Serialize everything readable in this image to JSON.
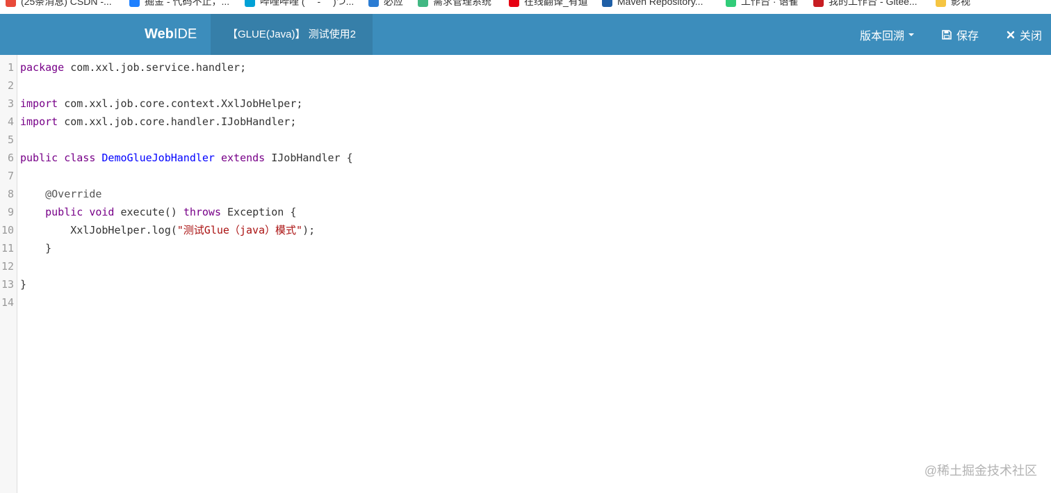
{
  "bookmarks": [
    {
      "label": "(25条消息) CSDN -...",
      "icon": "csdn-icon",
      "color": "#e84a3a"
    },
    {
      "label": "掘金 - 代码不止，...",
      "icon": "juejin-icon",
      "color": "#1e80ff"
    },
    {
      "label": "哔哩哔哩 ( ゜- ゜)つ...",
      "icon": "bilibili-icon",
      "color": "#00a1d6"
    },
    {
      "label": "必应",
      "icon": "bing-icon",
      "color": "#2b7cd3"
    },
    {
      "label": "需求管理系统",
      "icon": "vue-icon",
      "color": "#41b883"
    },
    {
      "label": "在线翻译_有道",
      "icon": "youdao-icon",
      "color": "#e60012"
    },
    {
      "label": "Maven Repository...",
      "icon": "maven-icon",
      "color": "#1f5fa6"
    },
    {
      "label": "工作台 · 语雀",
      "icon": "yuque-icon",
      "color": "#31cc79"
    },
    {
      "label": "我的工作台 - Gitee...",
      "icon": "gitee-icon",
      "color": "#c71d23"
    },
    {
      "label": "影视",
      "icon": "folder-icon",
      "color": "#f5c542"
    }
  ],
  "navbar": {
    "brand_prefix": "Web",
    "brand_suffix": "IDE",
    "file_title": "【GLUE(Java)】 测试使用2",
    "version_label": "版本回溯",
    "save_label": "保存",
    "close_label": "关闭",
    "bg_color": "#3c8dbc"
  },
  "editor": {
    "line_numbers": [
      "1",
      "2",
      "3",
      "4",
      "5",
      "6",
      "7",
      "8",
      "9",
      "10",
      "11",
      "12",
      "13",
      "14"
    ],
    "lines": [
      [
        {
          "t": "package",
          "c": "kw"
        },
        {
          "t": " com.xxl.job.service.handler;",
          "c": ""
        }
      ],
      [],
      [
        {
          "t": "import",
          "c": "kw"
        },
        {
          "t": " com.xxl.job.core.context.XxlJobHelper;",
          "c": ""
        }
      ],
      [
        {
          "t": "import",
          "c": "kw"
        },
        {
          "t": " com.xxl.job.core.handler.IJobHandler;",
          "c": ""
        }
      ],
      [],
      [
        {
          "t": "public",
          "c": "kw"
        },
        {
          "t": " ",
          "c": ""
        },
        {
          "t": "class",
          "c": "kw"
        },
        {
          "t": " ",
          "c": ""
        },
        {
          "t": "DemoGlueJobHandler",
          "c": "def"
        },
        {
          "t": " ",
          "c": ""
        },
        {
          "t": "extends",
          "c": "kw"
        },
        {
          "t": " IJobHandler {",
          "c": ""
        }
      ],
      [],
      [
        {
          "t": "    ",
          "c": ""
        },
        {
          "t": "@Override",
          "c": "meta"
        }
      ],
      [
        {
          "t": "    ",
          "c": ""
        },
        {
          "t": "public",
          "c": "kw"
        },
        {
          "t": " ",
          "c": ""
        },
        {
          "t": "void",
          "c": "kw"
        },
        {
          "t": " execute() ",
          "c": ""
        },
        {
          "t": "throws",
          "c": "kw"
        },
        {
          "t": " Exception {",
          "c": ""
        }
      ],
      [
        {
          "t": "        XxlJobHelper.log(",
          "c": ""
        },
        {
          "t": "\"测试Glue（java）模式\"",
          "c": "str"
        },
        {
          "t": ");",
          "c": ""
        }
      ],
      [
        {
          "t": "    }",
          "c": ""
        }
      ],
      [],
      [
        {
          "t": "}",
          "c": ""
        }
      ],
      []
    ]
  },
  "watermark": "@稀土掘金技术社区"
}
